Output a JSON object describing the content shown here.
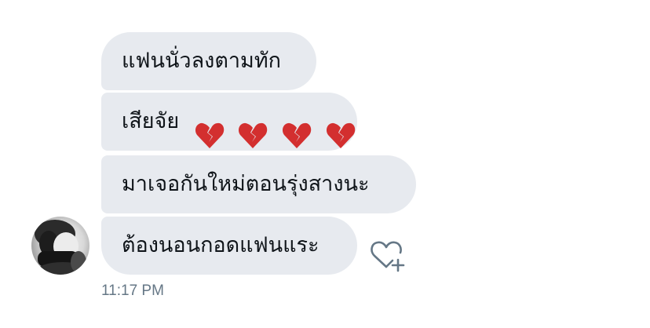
{
  "messages": [
    {
      "text": "แฟนนั่วลงตามทัก"
    },
    {
      "text": "เสียจัย",
      "emoji": [
        "broken-heart-icon",
        "broken-heart-icon",
        "broken-heart-icon",
        "broken-heart-icon"
      ]
    },
    {
      "text": "มาเจอกันใหม่ตอนรุ่งสางนะ"
    },
    {
      "text": "ต้องนอนกอดแฟนแระ"
    }
  ],
  "like_button_icon": "heart-plus-icon",
  "timestamp": "11:17 PM",
  "colors": {
    "bubble": "#e7eaef",
    "text": "#0f1419",
    "meta": "#657786",
    "broken_heart": "#d32f2f"
  }
}
